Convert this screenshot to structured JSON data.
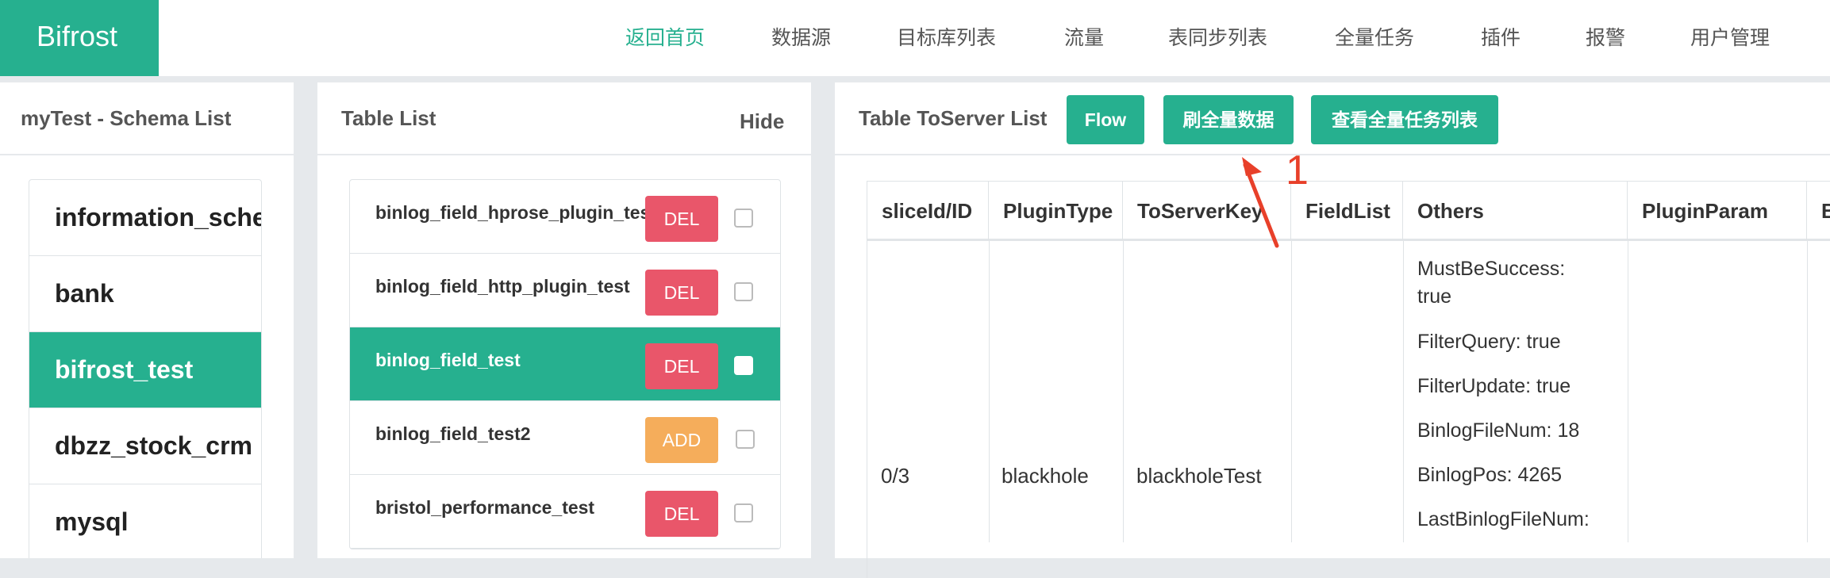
{
  "header": {
    "brand": "Bifrost",
    "nav": [
      {
        "label": "返回首页",
        "active": true
      },
      {
        "label": "数据源"
      },
      {
        "label": "目标库列表"
      },
      {
        "label": "流量"
      },
      {
        "label": "表同步列表"
      },
      {
        "label": "全量任务"
      },
      {
        "label": "插件"
      },
      {
        "label": "报警"
      },
      {
        "label": "用户管理"
      }
    ]
  },
  "schema_panel": {
    "title": "myTest - Schema List",
    "items": [
      "information_schema",
      "bank",
      "bifrost_test",
      "dbzz_stock_crm",
      "mysql"
    ],
    "active_item": "bifrost_test"
  },
  "table_panel": {
    "title": "Table List",
    "hide_label": "Hide",
    "rows": [
      {
        "name": "binlog_field_hprose_plugin_test",
        "button": "DEL"
      },
      {
        "name": "binlog_field_http_plugin_test",
        "button": "DEL"
      },
      {
        "name": "binlog_field_test",
        "button": "DEL",
        "active": true
      },
      {
        "name": "binlog_field_test2",
        "button": "ADD"
      },
      {
        "name": "bristol_performance_test",
        "button": "DEL"
      }
    ]
  },
  "server_panel": {
    "title": "Table ToServer List",
    "flow_button": "Flow",
    "refresh_full_button": "刷全量数据",
    "view_full_tasks_button": "查看全量任务列表",
    "annotation_number": "1",
    "columns": [
      "sliceId/ID",
      "PluginType",
      "ToServerKey",
      "FieldList",
      "Others",
      "PluginParam",
      "B"
    ],
    "row": {
      "slice_id": "0/3",
      "plugin_type": "blackhole",
      "to_server_key": "blackholeTest",
      "field_list": "",
      "others": [
        "MustBeSuccess:",
        "true",
        "FilterQuery: true",
        "FilterUpdate: true",
        "BinlogFileNum: 18",
        "BinlogPos: 4265",
        "LastBinlogFileNum:"
      ],
      "plugin_param": ""
    }
  },
  "colors": {
    "primary": "#26b08f",
    "danger": "#e9566a",
    "warning": "#f5ad5b",
    "annotation": "#e8402a"
  }
}
